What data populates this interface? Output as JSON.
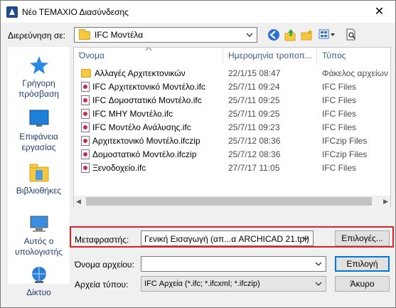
{
  "window": {
    "title": "Νέο ΤΕΜΑΧΙΟ Διασύνδεσης",
    "close_glyph": "✕"
  },
  "lookin": {
    "label": "Διερεύνηση σε:",
    "value": "IFC Μοντέλα"
  },
  "toolbar": {
    "icons": [
      "back-icon",
      "up-folder-icon",
      "new-folder-icon",
      "view-menu-icon",
      "preview-icon"
    ]
  },
  "places": [
    {
      "label": "Γρήγορη πρόσβαση",
      "icon": "quick-access-star-icon"
    },
    {
      "label": "Επιφάνεια εργασίας",
      "icon": "desktop-icon"
    },
    {
      "label": "Βιβλιοθήκες",
      "icon": "libraries-icon"
    },
    {
      "label": "Αυτός ο υπολογιστής",
      "icon": "this-pc-icon"
    },
    {
      "label": "Δίκτυο",
      "icon": "network-icon"
    }
  ],
  "list": {
    "columns": [
      "Όνομα",
      "Ημερομηνία τροποπ...",
      "Τύπος"
    ],
    "rows": [
      {
        "name": "Αλλαγές Αρχιτεκτονικών",
        "date": "22/1/15 08:47",
        "type": "Φάκελος αρχείων",
        "icon": "folder"
      },
      {
        "name": "IFC Αρχιτεκτονικό Μοντέλο.ifc",
        "date": "25/7/11 09:24",
        "type": "IFC Files",
        "icon": "ifc"
      },
      {
        "name": "IFC Δομοστατικό Μοντέλο.ifc",
        "date": "25/7/11 09:25",
        "type": "IFC Files",
        "icon": "ifc"
      },
      {
        "name": "IFC ΜΗΥ Μοντέλο.ifc",
        "date": "25/7/11 09:25",
        "type": "IFC Files",
        "icon": "ifc"
      },
      {
        "name": "IFC Μοντέλο Ανάλυσης.ifc",
        "date": "25/7/11 09:23",
        "type": "IFC Files",
        "icon": "ifc"
      },
      {
        "name": "Αρχιτεκτονικό Μοντέλο.ifczip",
        "date": "25/7/12 08:36",
        "type": "IFCzip Files",
        "icon": "ifczip"
      },
      {
        "name": "Δομοστατικό Μοντέλο.ifczip",
        "date": "25/7/12 08:36",
        "type": "IFCzip Files",
        "icon": "ifczip"
      },
      {
        "name": "Ξενοδοχείο.ifc",
        "date": "27/7/17 11:05",
        "type": "IFC Files",
        "icon": "ifc"
      }
    ]
  },
  "translator": {
    "label": "Μεταφραστής:",
    "value": "Γενική Εισαγωγή (απ...α ARCHICAD 21.tpl)",
    "options_button": "Επιλογές..."
  },
  "filename": {
    "label": "Όνομα αρχείου:",
    "value": "",
    "open_button": "Επιλογή"
  },
  "filetype": {
    "label": "Αρχεία τύπου:",
    "value": "IFC Αρχεία (*.ifc; *.ifcxml; *.ifczip)",
    "cancel_button": "Άκυρο"
  },
  "colors": {
    "highlight_border": "#d8232a",
    "default_button_border": "#0078d7",
    "place_label": "#1f3c6e",
    "column_header": "#3e5a86"
  }
}
